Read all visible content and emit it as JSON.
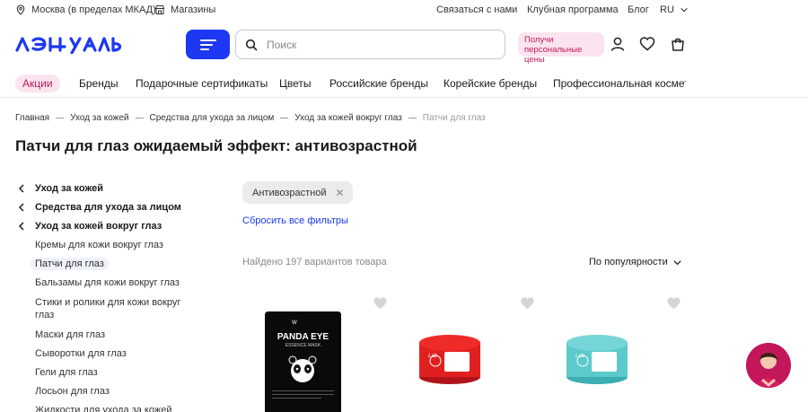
{
  "topbar": {
    "location": "Москва (в пределах МКАД)",
    "stores": "Магазины",
    "contact": "Связаться с нами",
    "club": "Клубная программа",
    "blog": "Блог",
    "lang": "RU"
  },
  "header": {
    "logo": "лэтуаль",
    "search_placeholder": "Поиск",
    "promo": "Получи персональные цены"
  },
  "nav": [
    "Акции",
    "Бренды",
    "Подарочные сертификаты",
    "Цветы",
    "Российские бренды",
    "Корейские бренды",
    "Профессиональная косметика"
  ],
  "breadcrumb": [
    "Главная",
    "Уход за кожей",
    "Средства для ухода за лицом",
    "Уход за кожей вокруг глаз",
    "Патчи для глаз"
  ],
  "page_title": "Патчи для глаз ожидаемый эффект: антивозрастной",
  "sidebar": {
    "parents": [
      "Уход за кожей",
      "Средства для ухода за лицом",
      "Уход за кожей вокруг глаз"
    ],
    "children": [
      "Кремы для кожи вокруг глаз",
      "Патчи для глаз",
      "Бальзамы для кожи вокруг глаз",
      "Стики и ролики для кожи вокруг глаз",
      "Маски для глаз",
      "Сыворотки для глаз",
      "Гели для глаз",
      "Лосьон для глаз",
      "Жидкости для ухода за кожей"
    ]
  },
  "filters": {
    "chip": "Антивозрастной",
    "reset": "Сбросить все фильтры",
    "found": "Найдено 197 вариантов товара",
    "sort": "По популярности"
  },
  "products": [
    {
      "brand_line1": "PANDA EYE",
      "brand_line2": "ESSENCE MASK"
    },
    {
      "label": "Lab"
    },
    {
      "label": "Lab"
    }
  ],
  "colors": {
    "accent": "#1c38f2",
    "pink": "#c2185b"
  }
}
